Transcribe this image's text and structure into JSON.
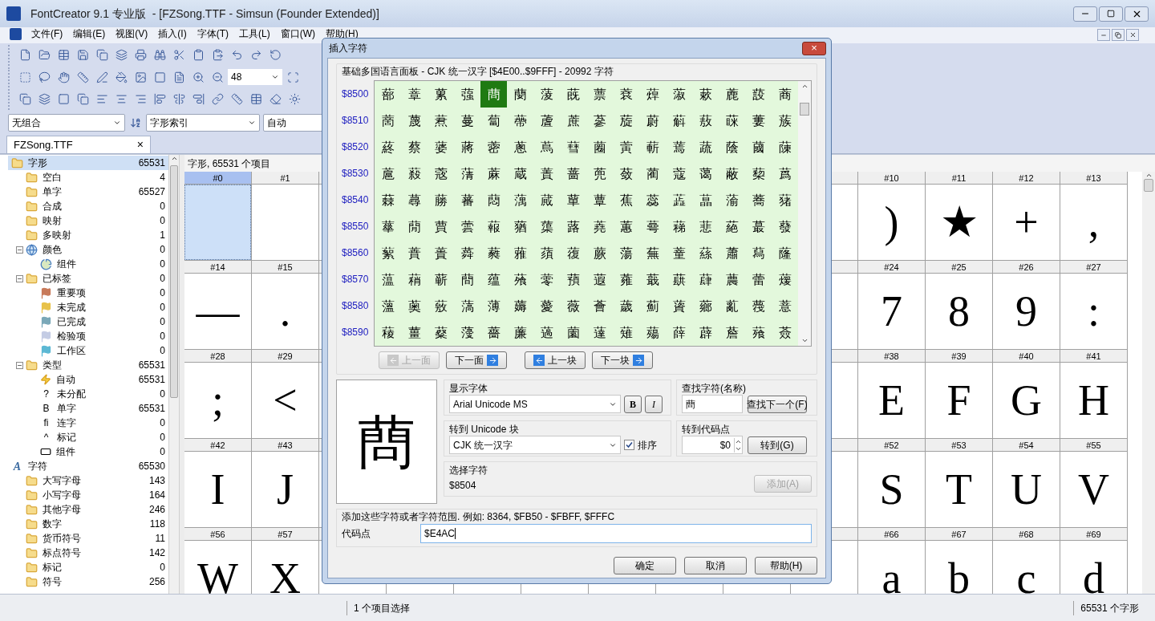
{
  "window": {
    "title": "FontCreator 9.1 专业版  - [FZSong.TTF - Simsun (Founder Extended)]"
  },
  "menu": [
    "文件(F)",
    "编辑(E)",
    "视图(V)",
    "插入(I)",
    "字体(T)",
    "工具(L)",
    "窗口(W)",
    "帮助(H)"
  ],
  "toolbar": {
    "zoom_value": "48",
    "combos": [
      "无组合",
      "字形索引",
      "自动"
    ]
  },
  "document_tab": {
    "label": "FZSong.TTF",
    "close": "×"
  },
  "tree": [
    {
      "label": "字形",
      "count": "65531",
      "kind": "folder",
      "selected": true,
      "children": [
        {
          "label": "空白",
          "count": "4",
          "kind": "folder",
          "selected": false
        },
        {
          "label": "单字",
          "count": "65527",
          "kind": "folder",
          "selected": false
        },
        {
          "label": "合成",
          "count": "0",
          "kind": "folder",
          "selected": false
        },
        {
          "label": "映射",
          "count": "0",
          "kind": "folder",
          "selected": false
        },
        {
          "label": "多映射",
          "count": "1",
          "kind": "folder",
          "selected": false
        },
        {
          "label": "颜色",
          "count": "0",
          "kind": "globe",
          "selected": false,
          "expanded": true,
          "children": [
            {
              "label": "组件",
              "count": "0",
              "kind": "pie",
              "selected": false
            }
          ]
        },
        {
          "label": "已标签",
          "count": "0",
          "kind": "folder",
          "selected": false,
          "expanded": true,
          "children": [
            {
              "label": "重要项",
              "count": "0",
              "kind": "flag",
              "color": "#c87a5a",
              "selected": false
            },
            {
              "label": "未完成",
              "count": "0",
              "kind": "flag",
              "color": "#e8c24a",
              "selected": false
            },
            {
              "label": "已完成",
              "count": "0",
              "kind": "flag",
              "color": "#7aa8b8",
              "selected": false
            },
            {
              "label": "检验项",
              "count": "0",
              "kind": "flag",
              "color": "#c4cce4",
              "selected": false
            },
            {
              "label": "工作区",
              "count": "0",
              "kind": "flag",
              "color": "#5cb8d4",
              "selected": false
            }
          ]
        },
        {
          "label": "类型",
          "count": "65531",
          "kind": "folder",
          "selected": false,
          "expanded": true,
          "children": [
            {
              "label": "自动",
              "count": "65531",
              "kind": "bolt",
              "selected": false
            },
            {
              "label": "未分配",
              "count": "0",
              "kind": "glyph",
              "glyph": "?",
              "selected": false
            },
            {
              "label": "单字",
              "count": "65531",
              "kind": "glyph",
              "glyph": "B",
              "selected": false
            },
            {
              "label": "连字",
              "count": "0",
              "kind": "glyph",
              "glyph": "fi",
              "selected": false
            },
            {
              "label": "标记",
              "count": "0",
              "kind": "glyph",
              "glyph": "^",
              "selected": false
            },
            {
              "label": "组件",
              "count": "0",
              "kind": "component",
              "selected": false
            }
          ]
        }
      ]
    },
    {
      "label": "字符",
      "count": "65530",
      "kind": "glyph",
      "glyph": "A",
      "selected": false,
      "children": [
        {
          "label": "大写字母",
          "count": "143",
          "kind": "folder",
          "selected": false
        },
        {
          "label": "小写字母",
          "count": "164",
          "kind": "folder",
          "selected": false
        },
        {
          "label": "其他字母",
          "count": "246",
          "kind": "folder",
          "selected": false
        },
        {
          "label": "数字",
          "count": "118",
          "kind": "folder",
          "selected": false
        },
        {
          "label": "货币符号",
          "count": "11",
          "kind": "folder",
          "selected": false
        },
        {
          "label": "标点符号",
          "count": "142",
          "kind": "folder",
          "selected": false
        },
        {
          "label": "标记",
          "count": "0",
          "kind": "folder",
          "selected": false
        },
        {
          "label": "符号",
          "count": "256",
          "kind": "folder",
          "selected": false
        }
      ]
    }
  ],
  "glyph_panel": {
    "header": "字形, 65531 个项目",
    "rows": [
      {
        "left": [
          {
            "label": "#0",
            "selected": true
          },
          {
            "label": "#1",
            "selected": false
          }
        ],
        "right": [
          {
            "label": "#10",
            "glyph": ")",
            "selected": false
          },
          {
            "label": "#11",
            "glyph": "★",
            "selected": false
          },
          {
            "label": "#12",
            "glyph": "+",
            "selected": false
          },
          {
            "label": "#13",
            "glyph": ",",
            "selected": false
          }
        ]
      },
      {
        "left": [
          {
            "label": "#14",
            "glyph": "—",
            "selected": false
          },
          {
            "label": "#15",
            "glyph": ".",
            "selected": false
          }
        ],
        "right": [
          {
            "label": "#24",
            "glyph": "7",
            "selected": false
          },
          {
            "label": "#25",
            "glyph": "8",
            "selected": false
          },
          {
            "label": "#26",
            "glyph": "9",
            "selected": false
          },
          {
            "label": "#27",
            "glyph": ":",
            "selected": false
          }
        ]
      },
      {
        "left": [
          {
            "label": "#28",
            "glyph": ";",
            "selected": false
          },
          {
            "label": "#29",
            "glyph": "<",
            "selected": false
          }
        ],
        "right": [
          {
            "label": "#38",
            "glyph": "E",
            "selected": false
          },
          {
            "label": "#39",
            "glyph": "F",
            "selected": false
          },
          {
            "label": "#40",
            "glyph": "G",
            "selected": false
          },
          {
            "label": "#41",
            "glyph": "H",
            "selected": false
          }
        ]
      },
      {
        "left": [
          {
            "label": "#42",
            "glyph": "I",
            "selected": false
          },
          {
            "label": "#43",
            "glyph": "J",
            "selected": false
          }
        ],
        "right": [
          {
            "label": "#52",
            "glyph": "S",
            "selected": false
          },
          {
            "label": "#53",
            "glyph": "T",
            "selected": false
          },
          {
            "label": "#54",
            "glyph": "U",
            "selected": false
          },
          {
            "label": "#55",
            "glyph": "V",
            "selected": false
          }
        ]
      },
      {
        "left": [
          {
            "label": "#56",
            "glyph": "W",
            "selected": false
          },
          {
            "label": "#57",
            "glyph": "X",
            "selected": false
          }
        ],
        "right": [
          {
            "label": "#66",
            "glyph": "a",
            "selected": false
          },
          {
            "label": "#67",
            "glyph": "b",
            "selected": false
          },
          {
            "label": "#68",
            "glyph": "c",
            "selected": false
          },
          {
            "label": "#69",
            "glyph": "d",
            "selected": false
          }
        ]
      }
    ]
  },
  "status_bar": {
    "selection": "1 个项目选择",
    "total": "65531 个字形"
  },
  "dialog": {
    "title": "插入字符",
    "close": "×",
    "group_title": "基础多国语言面板 - CJK 统一汉字 [$4E00..$9FFF] - 20992 字符",
    "rows": [
      {
        "label": "$8500",
        "cells": [
          {
            "ch": "蔀",
            "selected": false
          },
          {
            "ch": "蔁",
            "selected": false
          },
          {
            "ch": "蔂",
            "selected": false
          },
          {
            "ch": "蔃",
            "selected": false
          },
          {
            "ch": "蔄",
            "selected": true
          },
          {
            "ch": "蔅",
            "selected": false
          },
          {
            "ch": "蔆",
            "selected": false
          },
          {
            "ch": "蔇",
            "selected": false
          },
          {
            "ch": "蔈",
            "selected": false
          },
          {
            "ch": "蔉",
            "selected": false
          },
          {
            "ch": "蔊",
            "selected": false
          },
          {
            "ch": "蔋",
            "selected": false
          },
          {
            "ch": "蔌",
            "selected": false
          },
          {
            "ch": "蔍",
            "selected": false
          },
          {
            "ch": "蔎",
            "selected": false
          },
          {
            "ch": "蔏",
            "selected": false
          }
        ]
      },
      {
        "label": "$8510",
        "cells": [
          {
            "ch": "蔐",
            "selected": false
          },
          {
            "ch": "蔑",
            "selected": false
          },
          {
            "ch": "蔒",
            "selected": false
          },
          {
            "ch": "蔓",
            "selected": false
          },
          {
            "ch": "蔔",
            "selected": false
          },
          {
            "ch": "蔕",
            "selected": false
          },
          {
            "ch": "蔖",
            "selected": false
          },
          {
            "ch": "蔗",
            "selected": false
          },
          {
            "ch": "蔘",
            "selected": false
          },
          {
            "ch": "蔙",
            "selected": false
          },
          {
            "ch": "蔚",
            "selected": false
          },
          {
            "ch": "蔛",
            "selected": false
          },
          {
            "ch": "蔜",
            "selected": false
          },
          {
            "ch": "蔝",
            "selected": false
          },
          {
            "ch": "蔞",
            "selected": false
          },
          {
            "ch": "蔟",
            "selected": false
          }
        ]
      },
      {
        "label": "$8520",
        "cells": [
          {
            "ch": "蔠",
            "selected": false
          },
          {
            "ch": "蔡",
            "selected": false
          },
          {
            "ch": "蔢",
            "selected": false
          },
          {
            "ch": "蔣",
            "selected": false
          },
          {
            "ch": "蔤",
            "selected": false
          },
          {
            "ch": "蔥",
            "selected": false
          },
          {
            "ch": "蔦",
            "selected": false
          },
          {
            "ch": "蔧",
            "selected": false
          },
          {
            "ch": "蔨",
            "selected": false
          },
          {
            "ch": "蔩",
            "selected": false
          },
          {
            "ch": "蔪",
            "selected": false
          },
          {
            "ch": "蔫",
            "selected": false
          },
          {
            "ch": "蔬",
            "selected": false
          },
          {
            "ch": "蔭",
            "selected": false
          },
          {
            "ch": "蔮",
            "selected": false
          },
          {
            "ch": "蔯",
            "selected": false
          }
        ]
      },
      {
        "label": "$8530",
        "cells": [
          {
            "ch": "蔰",
            "selected": false
          },
          {
            "ch": "蔱",
            "selected": false
          },
          {
            "ch": "蔲",
            "selected": false
          },
          {
            "ch": "蔳",
            "selected": false
          },
          {
            "ch": "蔴",
            "selected": false
          },
          {
            "ch": "蔵",
            "selected": false
          },
          {
            "ch": "蔶",
            "selected": false
          },
          {
            "ch": "蔷",
            "selected": false
          },
          {
            "ch": "蔸",
            "selected": false
          },
          {
            "ch": "蔹",
            "selected": false
          },
          {
            "ch": "蔺",
            "selected": false
          },
          {
            "ch": "蔻",
            "selected": false
          },
          {
            "ch": "蔼",
            "selected": false
          },
          {
            "ch": "蔽",
            "selected": false
          },
          {
            "ch": "蔾",
            "selected": false
          },
          {
            "ch": "蔿",
            "selected": false
          }
        ]
      },
      {
        "label": "$8540",
        "cells": [
          {
            "ch": "蕀",
            "selected": false
          },
          {
            "ch": "蕁",
            "selected": false
          },
          {
            "ch": "蕂",
            "selected": false
          },
          {
            "ch": "蕃",
            "selected": false
          },
          {
            "ch": "蕄",
            "selected": false
          },
          {
            "ch": "蕅",
            "selected": false
          },
          {
            "ch": "蕆",
            "selected": false
          },
          {
            "ch": "蕇",
            "selected": false
          },
          {
            "ch": "蕈",
            "selected": false
          },
          {
            "ch": "蕉",
            "selected": false
          },
          {
            "ch": "蕊",
            "selected": false
          },
          {
            "ch": "蕋",
            "selected": false
          },
          {
            "ch": "蕌",
            "selected": false
          },
          {
            "ch": "蕍",
            "selected": false
          },
          {
            "ch": "蕎",
            "selected": false
          },
          {
            "ch": "蕏",
            "selected": false
          }
        ]
      },
      {
        "label": "$8550",
        "cells": [
          {
            "ch": "蕐",
            "selected": false
          },
          {
            "ch": "蕑",
            "selected": false
          },
          {
            "ch": "蕒",
            "selected": false
          },
          {
            "ch": "蕓",
            "selected": false
          },
          {
            "ch": "蕔",
            "selected": false
          },
          {
            "ch": "蕕",
            "selected": false
          },
          {
            "ch": "蕖",
            "selected": false
          },
          {
            "ch": "蕗",
            "selected": false
          },
          {
            "ch": "蕘",
            "selected": false
          },
          {
            "ch": "蕙",
            "selected": false
          },
          {
            "ch": "蕚",
            "selected": false
          },
          {
            "ch": "蕛",
            "selected": false
          },
          {
            "ch": "蕜",
            "selected": false
          },
          {
            "ch": "蕝",
            "selected": false
          },
          {
            "ch": "蕞",
            "selected": false
          },
          {
            "ch": "蕟",
            "selected": false
          }
        ]
      },
      {
        "label": "$8560",
        "cells": [
          {
            "ch": "蕠",
            "selected": false
          },
          {
            "ch": "蕡",
            "selected": false
          },
          {
            "ch": "蕢",
            "selected": false
          },
          {
            "ch": "蕣",
            "selected": false
          },
          {
            "ch": "蕤",
            "selected": false
          },
          {
            "ch": "蕥",
            "selected": false
          },
          {
            "ch": "蕦",
            "selected": false
          },
          {
            "ch": "蕧",
            "selected": false
          },
          {
            "ch": "蕨",
            "selected": false
          },
          {
            "ch": "蕩",
            "selected": false
          },
          {
            "ch": "蕪",
            "selected": false
          },
          {
            "ch": "蕫",
            "selected": false
          },
          {
            "ch": "蕬",
            "selected": false
          },
          {
            "ch": "蕭",
            "selected": false
          },
          {
            "ch": "蕮",
            "selected": false
          },
          {
            "ch": "蕯",
            "selected": false
          }
        ]
      },
      {
        "label": "$8570",
        "cells": [
          {
            "ch": "蕰",
            "selected": false
          },
          {
            "ch": "蕱",
            "selected": false
          },
          {
            "ch": "蕲",
            "selected": false
          },
          {
            "ch": "蕳",
            "selected": false
          },
          {
            "ch": "蕴",
            "selected": false
          },
          {
            "ch": "蕵",
            "selected": false
          },
          {
            "ch": "蕶",
            "selected": false
          },
          {
            "ch": "蕷",
            "selected": false
          },
          {
            "ch": "蕸",
            "selected": false
          },
          {
            "ch": "蕹",
            "selected": false
          },
          {
            "ch": "蕺",
            "selected": false
          },
          {
            "ch": "蕻",
            "selected": false
          },
          {
            "ch": "蕼",
            "selected": false
          },
          {
            "ch": "蕽",
            "selected": false
          },
          {
            "ch": "蕾",
            "selected": false
          },
          {
            "ch": "蕿",
            "selected": false
          }
        ]
      },
      {
        "label": "$8580",
        "cells": [
          {
            "ch": "薀",
            "selected": false
          },
          {
            "ch": "薁",
            "selected": false
          },
          {
            "ch": "薂",
            "selected": false
          },
          {
            "ch": "薃",
            "selected": false
          },
          {
            "ch": "薄",
            "selected": false
          },
          {
            "ch": "薅",
            "selected": false
          },
          {
            "ch": "薆",
            "selected": false
          },
          {
            "ch": "薇",
            "selected": false
          },
          {
            "ch": "薈",
            "selected": false
          },
          {
            "ch": "薉",
            "selected": false
          },
          {
            "ch": "薊",
            "selected": false
          },
          {
            "ch": "薋",
            "selected": false
          },
          {
            "ch": "薌",
            "selected": false
          },
          {
            "ch": "薍",
            "selected": false
          },
          {
            "ch": "薎",
            "selected": false
          },
          {
            "ch": "薏",
            "selected": false
          }
        ]
      },
      {
        "label": "$8590",
        "cells": [
          {
            "ch": "薐",
            "selected": false
          },
          {
            "ch": "薑",
            "selected": false
          },
          {
            "ch": "薒",
            "selected": false
          },
          {
            "ch": "薓",
            "selected": false
          },
          {
            "ch": "薔",
            "selected": false
          },
          {
            "ch": "薕",
            "selected": false
          },
          {
            "ch": "薖",
            "selected": false
          },
          {
            "ch": "薗",
            "selected": false
          },
          {
            "ch": "薘",
            "selected": false
          },
          {
            "ch": "薙",
            "selected": false
          },
          {
            "ch": "薚",
            "selected": false
          },
          {
            "ch": "薛",
            "selected": false
          },
          {
            "ch": "薜",
            "selected": false
          },
          {
            "ch": "薝",
            "selected": false
          },
          {
            "ch": "薞",
            "selected": false
          },
          {
            "ch": "薟",
            "selected": false
          }
        ]
      }
    ],
    "nav_buttons": [
      {
        "label": "上一面",
        "disabled": true
      },
      {
        "label": "下一面",
        "disabled": false
      },
      {
        "label": "上一块",
        "disabled": false
      },
      {
        "label": "下一块",
        "disabled": false
      }
    ],
    "preview_char": "蔄",
    "display_font": {
      "label": "显示字体",
      "value": "Arial Unicode MS",
      "bold_button": "B",
      "italic_button": "I"
    },
    "find_char": {
      "label": "查找字符(名称)",
      "value": "蔄",
      "button": "查找下一个(F)"
    },
    "unicode_block": {
      "label": "转到 Unicode 块",
      "value": "CJK 统一汉字",
      "sort_label": "排序",
      "sort_checked": true
    },
    "goto_codepoint": {
      "label": "转到代码点",
      "value": "$0",
      "button": "转到(G)"
    },
    "selected_char": {
      "label": "选择字符",
      "value": "$8504",
      "add_button": "添加(A)",
      "add_disabled": true
    },
    "range_hint": "添加这些字符或者字符范围. 例如: 8364, $FB50 - $FBFF, $FFFC",
    "codepoint": {
      "label": "代码点",
      "value": "$E4AC"
    },
    "buttons": [
      "确定",
      "取消",
      "帮助(H)"
    ]
  }
}
